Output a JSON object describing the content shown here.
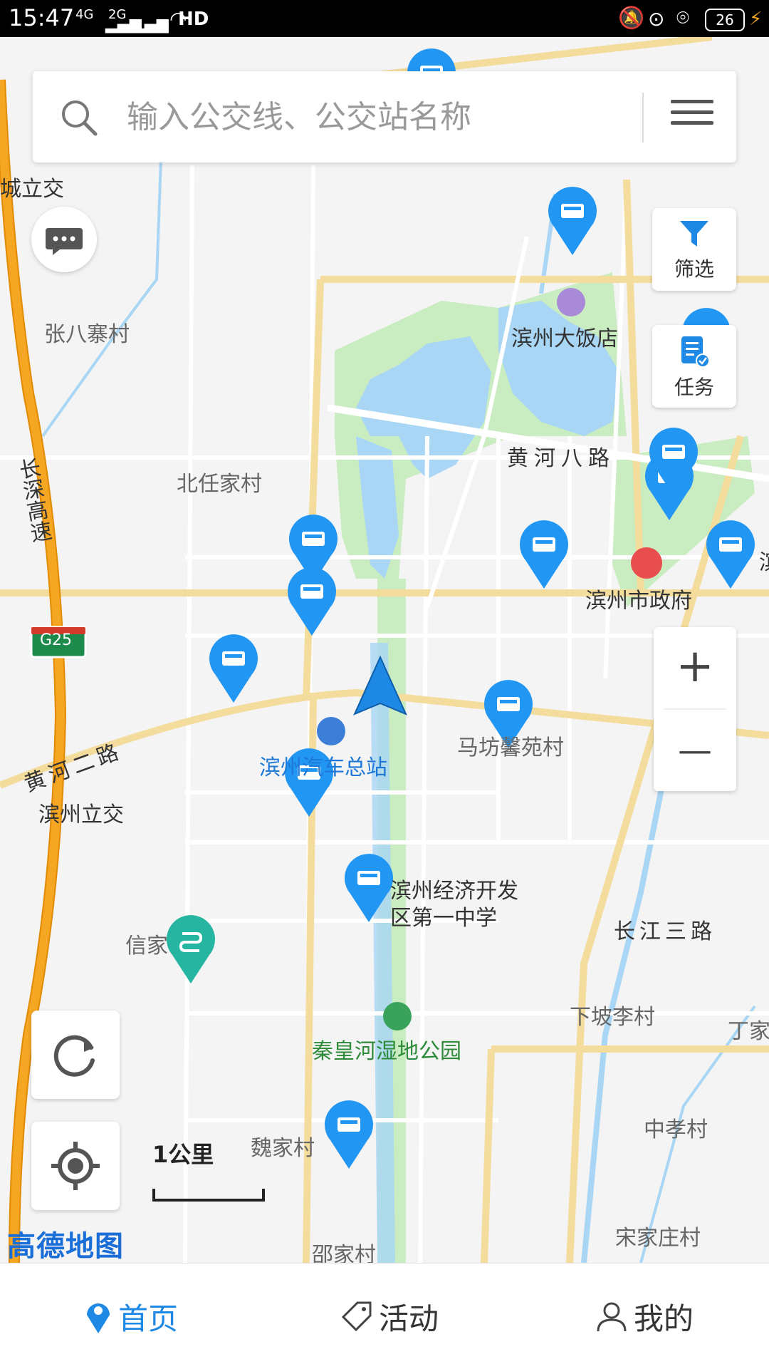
{
  "status_bar": {
    "time": "15:47",
    "network_1": "4G",
    "network_2": "2G",
    "wifi": "HD",
    "battery": "26"
  },
  "search": {
    "placeholder": "输入公交线、公交站名称"
  },
  "buttons": {
    "filter_label": "筛选",
    "task_label": "任务",
    "zoom_in": "+",
    "zoom_out": "—"
  },
  "map": {
    "scale_text": "1公里",
    "provider_logo": "高德地图",
    "labels": {
      "chengliji": "城立交",
      "zhangbazhai": "张八寨村",
      "changshen": "长深高速",
      "g25": "G25",
      "beirenjia": "北任家村",
      "binzhou_hotel": "滨州大饭店",
      "huanghe_8": "黄河八路",
      "city_gov": "滨州市政府",
      "bin_cut": "滨",
      "huanghe_2": "黄河二路",
      "binzhou_interchange": "滨州立交",
      "bus_station": "滨州汽车总站",
      "mafang": "马坊馨苑村",
      "school": "滨州经济开发\n区第一中学",
      "changjiang_3": "长江三路",
      "xinjia": "信家",
      "xiapoli": "下坡李村",
      "dingjia": "丁家",
      "qinhuanghe": "秦皇河湿地公园",
      "weijia": "魏家村",
      "zhongxiao": "中孝村",
      "shaojia": "邵家村",
      "songjiazhuang": "宋家庄村"
    }
  },
  "tabs": [
    {
      "label": "首页",
      "active": true
    },
    {
      "label": "活动",
      "active": false
    },
    {
      "label": "我的",
      "active": false
    }
  ],
  "colors": {
    "accent": "#1e88e5",
    "pin": "#2196f3",
    "route_pin": "#26b5a0",
    "park": "#c9ecc0",
    "water": "#a9d6f5",
    "highway": "#f5a623",
    "road": "#f5dfa0"
  }
}
